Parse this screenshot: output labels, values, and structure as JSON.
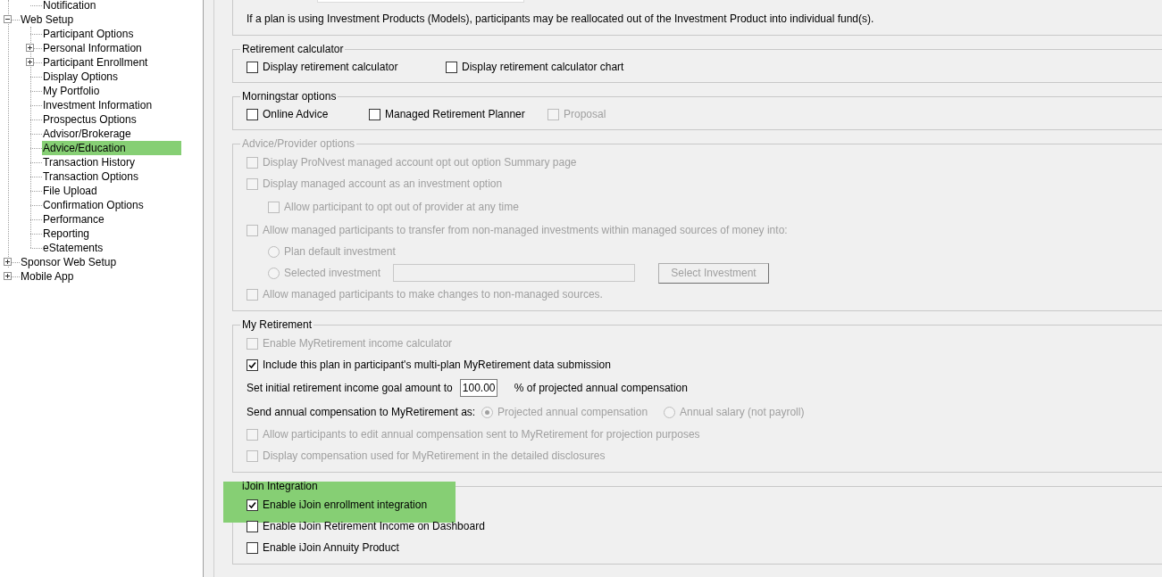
{
  "tree_partial": [
    {
      "label": "Notification"
    }
  ],
  "tree": [
    {
      "label": "Web Setup",
      "expanded": true,
      "selected": false,
      "children": [
        {
          "label": "Participant Options",
          "selected": false
        },
        {
          "label": "Personal Information",
          "selected": false,
          "expanded": false
        },
        {
          "label": "Participant Enrollment",
          "selected": false,
          "expanded": false
        },
        {
          "label": "Display Options",
          "selected": false
        },
        {
          "label": "My Portfolio",
          "selected": false
        },
        {
          "label": "Investment Information",
          "selected": false
        },
        {
          "label": "Prospectus Options",
          "selected": false
        },
        {
          "label": "Advisor/Brokerage",
          "selected": false
        },
        {
          "label": "Advice/Education",
          "selected": true
        },
        {
          "label": "Transaction History",
          "selected": false
        },
        {
          "label": "Transaction Options",
          "selected": false
        },
        {
          "label": "File Upload",
          "selected": false
        },
        {
          "label": "Confirmation Options",
          "selected": false
        },
        {
          "label": "Performance",
          "selected": false
        },
        {
          "label": "Reporting",
          "selected": false
        },
        {
          "label": "eStatements",
          "selected": false
        }
      ]
    },
    {
      "label": "Sponsor Web Setup",
      "expanded": false,
      "selected": false
    },
    {
      "label": "Mobile App",
      "expanded": false,
      "selected": false
    }
  ],
  "notice": "If a plan is using Investment Products (Models), participants may be reallocated out of the Investment Product into individual fund(s).",
  "groups": [
    {
      "title": "Retirement calculator",
      "disabled": false,
      "highlighted": false,
      "rows": [
        {
          "kind": "checks",
          "items": [
            {
              "label": "Display retirement calculator",
              "checked": false,
              "disabled": false
            },
            {
              "label": "Display retirement calculator chart",
              "checked": false,
              "disabled": false
            }
          ]
        }
      ]
    },
    {
      "title": "Morningstar options",
      "disabled": false,
      "highlighted": false,
      "rows": [
        {
          "kind": "checks",
          "items": [
            {
              "label": "Online Advice",
              "checked": false,
              "disabled": false
            },
            {
              "label": "Managed Retirement Planner",
              "checked": false,
              "disabled": false
            },
            {
              "label": "Proposal",
              "checked": false,
              "disabled": true
            }
          ]
        }
      ]
    },
    {
      "title": "Advice/Provider options",
      "disabled": true,
      "highlighted": false,
      "rows": [
        {
          "kind": "check",
          "label": "Display ProNvest managed account opt out option Summary page",
          "checked": false,
          "disabled": true
        },
        {
          "kind": "check",
          "label": "Display managed account as an investment option",
          "checked": false,
          "disabled": true
        },
        {
          "kind": "subcheck",
          "label": "Allow participant to opt out of provider at any time",
          "checked": false,
          "disabled": true
        },
        {
          "kind": "check",
          "label": "Allow managed participants to transfer from non-managed investments within managed sources of money into:",
          "checked": false,
          "disabled": true
        },
        {
          "kind": "radio",
          "label": "Plan default investment",
          "selected": false,
          "disabled": true
        },
        {
          "kind": "radio_pick",
          "label": "Selected investment",
          "selected": false,
          "disabled": true,
          "button": "Select Investment"
        },
        {
          "kind": "check",
          "label": "Allow managed participants to make changes to non-managed sources.",
          "checked": false,
          "disabled": true
        }
      ]
    },
    {
      "title": "My Retirement",
      "disabled": false,
      "highlighted": false,
      "rows": [
        {
          "kind": "check",
          "label": "Enable MyRetirement income calculator",
          "checked": false,
          "disabled": true
        },
        {
          "kind": "check",
          "label": "Include this plan in participant's multi-plan MyRetirement data submission",
          "checked": true,
          "disabled": false
        },
        {
          "kind": "amount",
          "label": "Set initial retirement income goal amount to",
          "value": "100.00",
          "suffix": "% of projected annual compensation"
        },
        {
          "kind": "choice",
          "label": "Send annual compensation to MyRetirement as:",
          "options": [
            {
              "label": "Projected annual compensation",
              "selected": true,
              "disabled": true
            },
            {
              "label": "Annual salary (not payroll)",
              "selected": false,
              "disabled": true
            }
          ]
        },
        {
          "kind": "check",
          "label": "Allow participants to edit annual compensation sent to MyRetirement for projection purposes",
          "checked": false,
          "disabled": true
        },
        {
          "kind": "check",
          "label": "Display compensation used for MyRetirement in the detailed disclosures",
          "checked": false,
          "disabled": true
        }
      ]
    },
    {
      "title": "iJoin Integration",
      "disabled": false,
      "highlighted": true,
      "rows": [
        {
          "kind": "check",
          "label": "Enable iJoin enrollment integration",
          "checked": true,
          "disabled": false
        },
        {
          "kind": "check",
          "label": "Enable iJoin Retirement Income on Dashboard",
          "checked": false,
          "disabled": false
        },
        {
          "kind": "check",
          "label": "Enable iJoin Annuity Product",
          "checked": false,
          "disabled": false
        }
      ]
    }
  ]
}
